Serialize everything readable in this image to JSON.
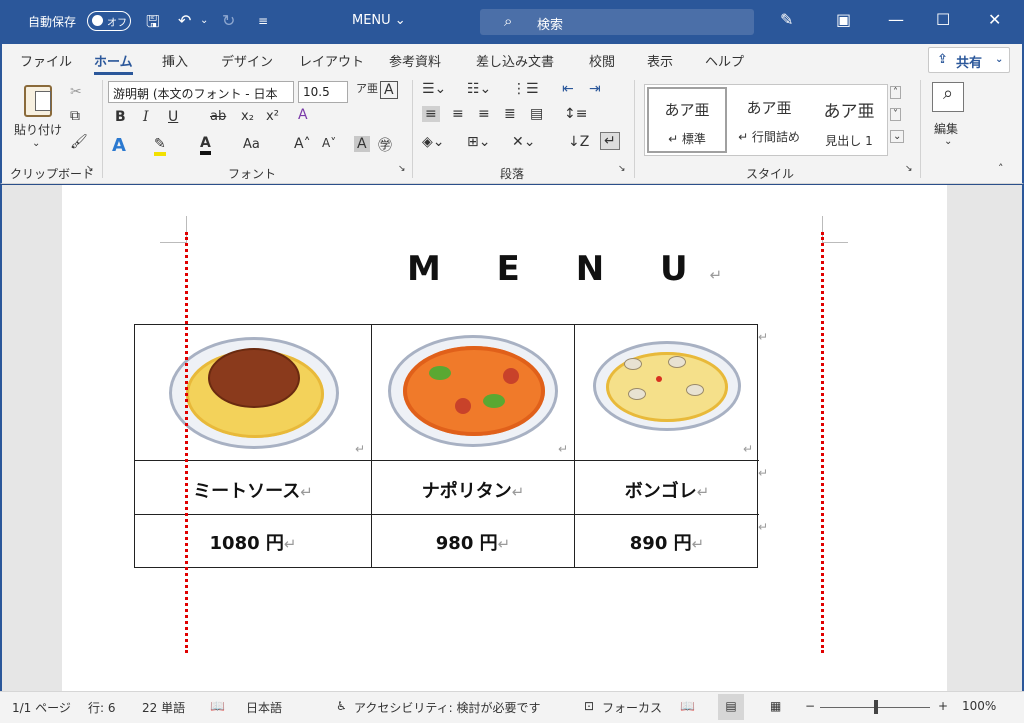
{
  "titlebar": {
    "autosave_label": "自動保存",
    "autosave_state": "オフ",
    "doc_title": "MENU ⌄",
    "search_placeholder": "検索",
    "save_icon": "save-icon",
    "undo_icon": "undo-icon",
    "redo_icon": "redo-icon"
  },
  "tabs": [
    "ファイル",
    "ホーム",
    "挿入",
    "デザイン",
    "レイアウト",
    "参考資料",
    "差し込み文書",
    "校閲",
    "表示",
    "ヘルプ"
  ],
  "share_label": "共有",
  "ribbon": {
    "clipboard": {
      "paste_label": "貼り付け",
      "group_label": "クリップボード"
    },
    "font": {
      "font_name": "游明朝 (本文のフォント - 日本",
      "font_size": "10.5",
      "group_label": "フォント"
    },
    "paragraph": {
      "group_label": "段落"
    },
    "styles": {
      "group_label": "スタイル",
      "cards": [
        {
          "sample": "あア亜",
          "name": "↵ 標準"
        },
        {
          "sample": "あア亜",
          "name": "↵ 行間詰め"
        },
        {
          "sample": "あア亜",
          "name": "見出し 1"
        }
      ]
    },
    "editing": {
      "label": "編集"
    }
  },
  "document": {
    "title": "M E N U",
    "items": [
      {
        "name": "ミートソース",
        "price": "1080 円"
      },
      {
        "name": "ナポリタン",
        "price": "980 円"
      },
      {
        "name": "ボンゴレ",
        "price": "890 円"
      }
    ]
  },
  "statusbar": {
    "page": "1/1 ページ",
    "line": "行: 6",
    "words": "22 単語",
    "language": "日本語",
    "accessibility": "アクセシビリティ: 検討が必要です",
    "focus": "フォーカス",
    "zoom": "100%"
  },
  "colors": {
    "accent": "#2b579a",
    "guide_line": "#e00000"
  }
}
